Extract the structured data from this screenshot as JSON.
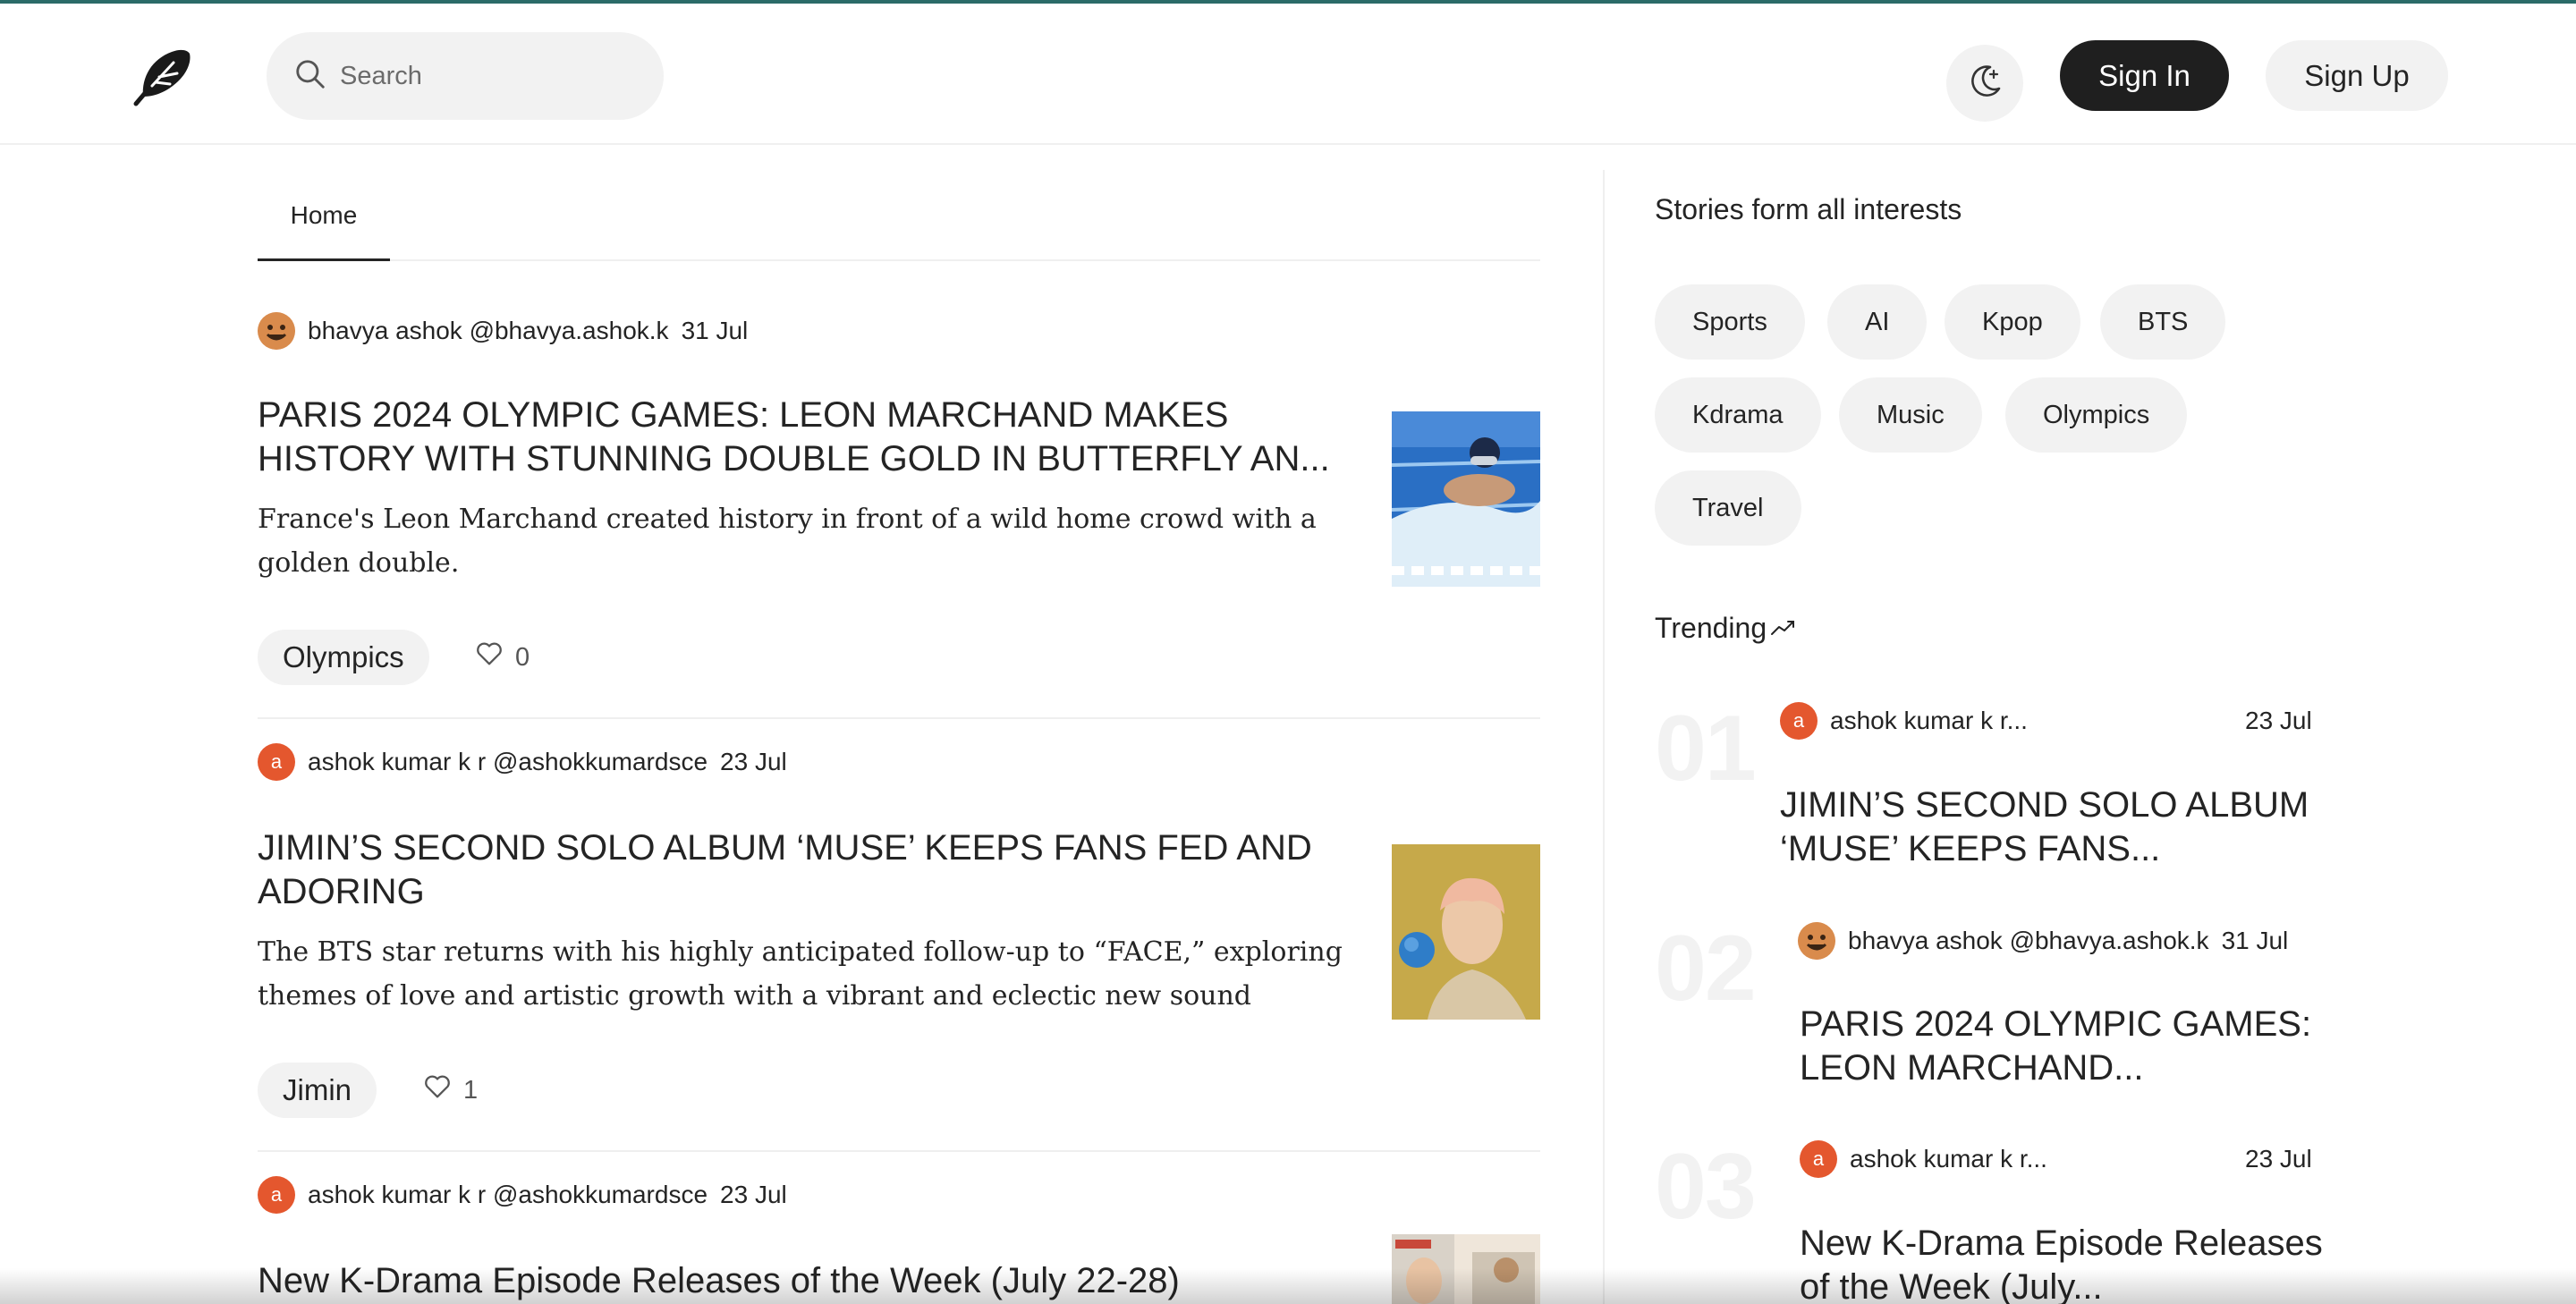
{
  "header": {
    "search_placeholder": "Search",
    "signin_label": "Sign In",
    "signup_label": "Sign Up"
  },
  "tabs": {
    "home": "Home"
  },
  "articles": [
    {
      "author": "bhavya ashok @bhavya.ashok.k",
      "date": "31 Jul",
      "title": "PARIS 2024 OLYMPIC GAMES: LEON MARCHAND MAKES HISTORY WITH STUNNING DOUBLE GOLD IN BUTTERFLY AN...",
      "excerpt": "France's Leon Marchand created history in front of a wild home crowd with a golden double.",
      "tag": "Olympics",
      "likes": "0"
    },
    {
      "author": "ashok kumar k r @ashokkumardsce",
      "avatar_letter": "a",
      "date": "23 Jul",
      "title": "JIMIN’S SECOND SOLO ALBUM ‘MUSE’ KEEPS FANS FED AND ADORING",
      "excerpt": "The BTS star returns with his highly anticipated follow-up to “FACE,” exploring themes of love and artistic growth with a vibrant and eclectic new sound",
      "tag": "Jimin",
      "likes": "1"
    },
    {
      "author": "ashok kumar k r @ashokkumardsce",
      "avatar_letter": "a",
      "date": "23 Jul",
      "title": "New K-Drama Episode Releases of the Week (July 22-28)"
    }
  ],
  "sidebar": {
    "title": "Stories form all interests",
    "topics": [
      "Sports",
      "AI",
      "Kpop",
      "BTS",
      "Kdrama",
      "Music",
      "Olympics",
      "Travel"
    ],
    "trending_label": "Trending",
    "trending": [
      {
        "num": "01",
        "author": "ashok kumar k r...",
        "avatar_letter": "a",
        "date": "23 Jul",
        "title": "JIMIN’S SECOND SOLO ALBUM ‘MUSE’ KEEPS FANS..."
      },
      {
        "num": "02",
        "author": "bhavya ashok @bhavya.ashok.k",
        "date": "31 Jul",
        "title": "PARIS 2024 OLYMPIC GAMES: LEON MARCHAND..."
      },
      {
        "num": "03",
        "author": "ashok kumar k r...",
        "avatar_letter": "a",
        "date": "23 Jul",
        "title": "New K-Drama Episode Releases of the Week (July..."
      }
    ]
  },
  "icons": {
    "logo": "feather-logo-icon",
    "search": "search-icon",
    "theme": "moon-sparkle-icon",
    "like": "heart-icon",
    "trending": "trending-up-icon"
  },
  "colors": {
    "accent_dark": "#1f1f1f",
    "chip_bg": "#f2f2f2",
    "avatar_orange": "#e4572e",
    "top_line": "#2b6b68"
  }
}
